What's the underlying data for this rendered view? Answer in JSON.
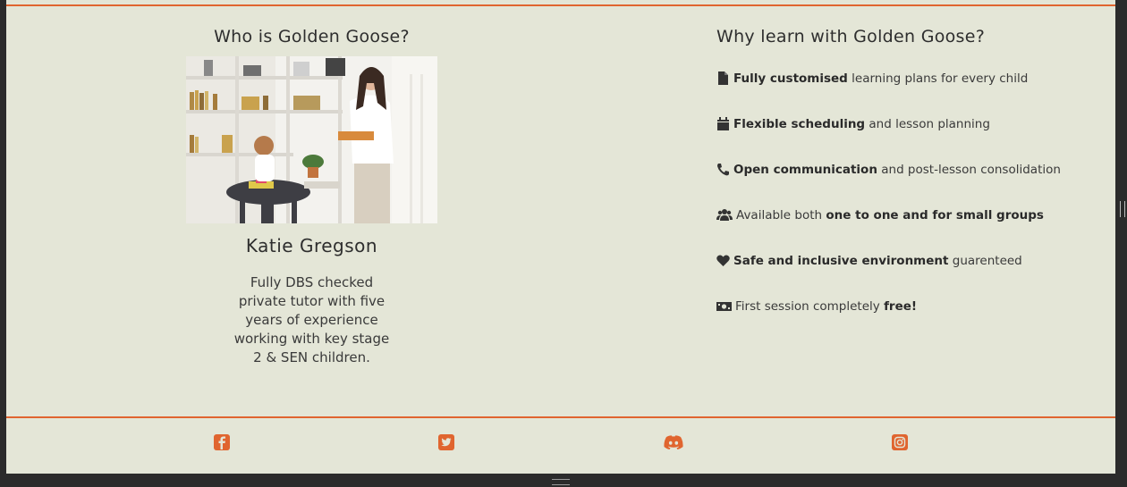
{
  "who": {
    "title": "Who is Golden Goose?",
    "tutor_name": "Katie Gregson",
    "bio": "Fully DBS checked private tutor with five years of experience working with key stage 2 & SEN children."
  },
  "why": {
    "title": "Why learn with Golden Goose?",
    "features": [
      {
        "icon": "file-icon",
        "parts": [
          {
            "bold": true,
            "text": "Fully customised"
          },
          {
            "bold": false,
            "text": " learning plans for every child"
          }
        ]
      },
      {
        "icon": "calendar-icon",
        "parts": [
          {
            "bold": true,
            "text": "Flexible scheduling"
          },
          {
            "bold": false,
            "text": " and lesson planning"
          }
        ]
      },
      {
        "icon": "phone-icon",
        "parts": [
          {
            "bold": true,
            "text": "Open communication"
          },
          {
            "bold": false,
            "text": " and post-lesson consolidation"
          }
        ]
      },
      {
        "icon": "users-icon",
        "parts": [
          {
            "bold": false,
            "text": "Available both "
          },
          {
            "bold": true,
            "text": "one to one and for small groups"
          }
        ]
      },
      {
        "icon": "heart-icon",
        "parts": [
          {
            "bold": true,
            "text": "Safe and inclusive environment"
          },
          {
            "bold": false,
            "text": " guarenteed"
          }
        ]
      },
      {
        "icon": "money-icon",
        "parts": [
          {
            "bold": false,
            "text": "First session completely "
          },
          {
            "bold": true,
            "text": "free!"
          }
        ]
      }
    ]
  },
  "footer": {
    "social": [
      {
        "name": "facebook-icon"
      },
      {
        "name": "twitter-icon"
      },
      {
        "name": "discord-icon"
      },
      {
        "name": "instagram-icon"
      }
    ]
  },
  "colors": {
    "accent": "#e0652f",
    "background": "#e4e6d7",
    "text": "#2e2e2e"
  }
}
